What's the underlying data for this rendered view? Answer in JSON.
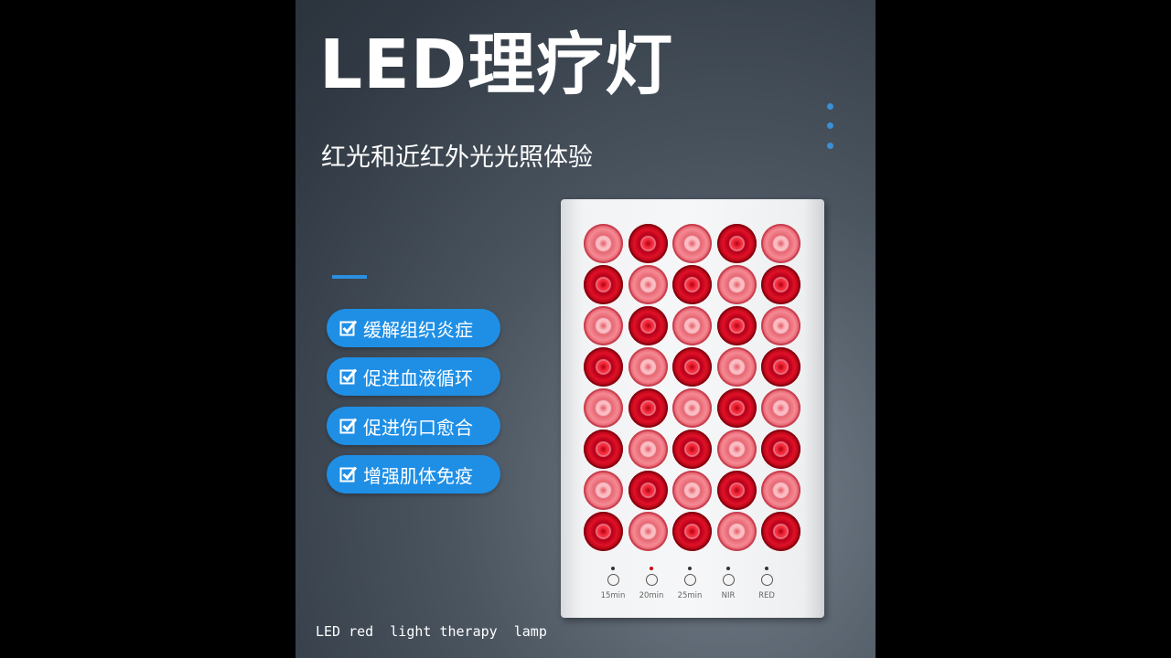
{
  "title": "LED理疗灯",
  "subtitle": "红光和近红外光光照体验",
  "features": [
    "缓解组织炎症",
    "促进血液循环",
    "促进伤口愈合",
    "增强肌体免疫"
  ],
  "device": {
    "controls": [
      {
        "label": "15min",
        "indicator_on": false
      },
      {
        "label": "20min",
        "indicator_on": true
      },
      {
        "label": "25min",
        "indicator_on": false
      },
      {
        "label": "NIR",
        "indicator_on": false
      },
      {
        "label": "RED",
        "indicator_on": false
      }
    ],
    "led_rows": 8,
    "led_cols": 5,
    "led_colors": {
      "red": "#e01127",
      "nir": "#f58a94"
    }
  },
  "caption": "LED red  light therapy  lamp",
  "colors": {
    "accent": "#1f8fe6",
    "background": "#3b444f"
  },
  "icons": {
    "feature_icon": "checkbox-checked-icon",
    "decoration": "vertical-dots-icon"
  }
}
